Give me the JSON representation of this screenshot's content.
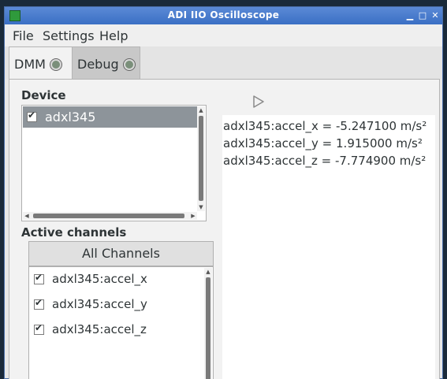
{
  "window": {
    "title": "ADI IIO Oscilloscope"
  },
  "menu": {
    "items": [
      "File",
      "Settings",
      "Help"
    ]
  },
  "tabs": [
    {
      "label": "DMM",
      "active": true
    },
    {
      "label": "Debug",
      "active": false
    }
  ],
  "device_section": {
    "label": "Device",
    "devices": [
      {
        "name": "adxl345",
        "checked": true,
        "selected": true
      }
    ]
  },
  "channels_section": {
    "label": "Active channels",
    "all_button": "All Channels",
    "channels": [
      {
        "name": "adxl345:accel_x",
        "checked": true
      },
      {
        "name": "adxl345:accel_y",
        "checked": true
      },
      {
        "name": "adxl345:accel_z",
        "checked": true
      }
    ]
  },
  "readings": [
    "adxl345:accel_x = -5.247100 m/s²",
    "adxl345:accel_y = 1.915000 m/s²",
    "adxl345:accel_z = -7.774900 m/s²"
  ],
  "colors": {
    "titlebar": "#3a6fc4",
    "selection": "#8d949a"
  },
  "icons": {
    "app": "oscilloscope-app-icon",
    "tab": "gear-icon",
    "play": "play-icon"
  }
}
